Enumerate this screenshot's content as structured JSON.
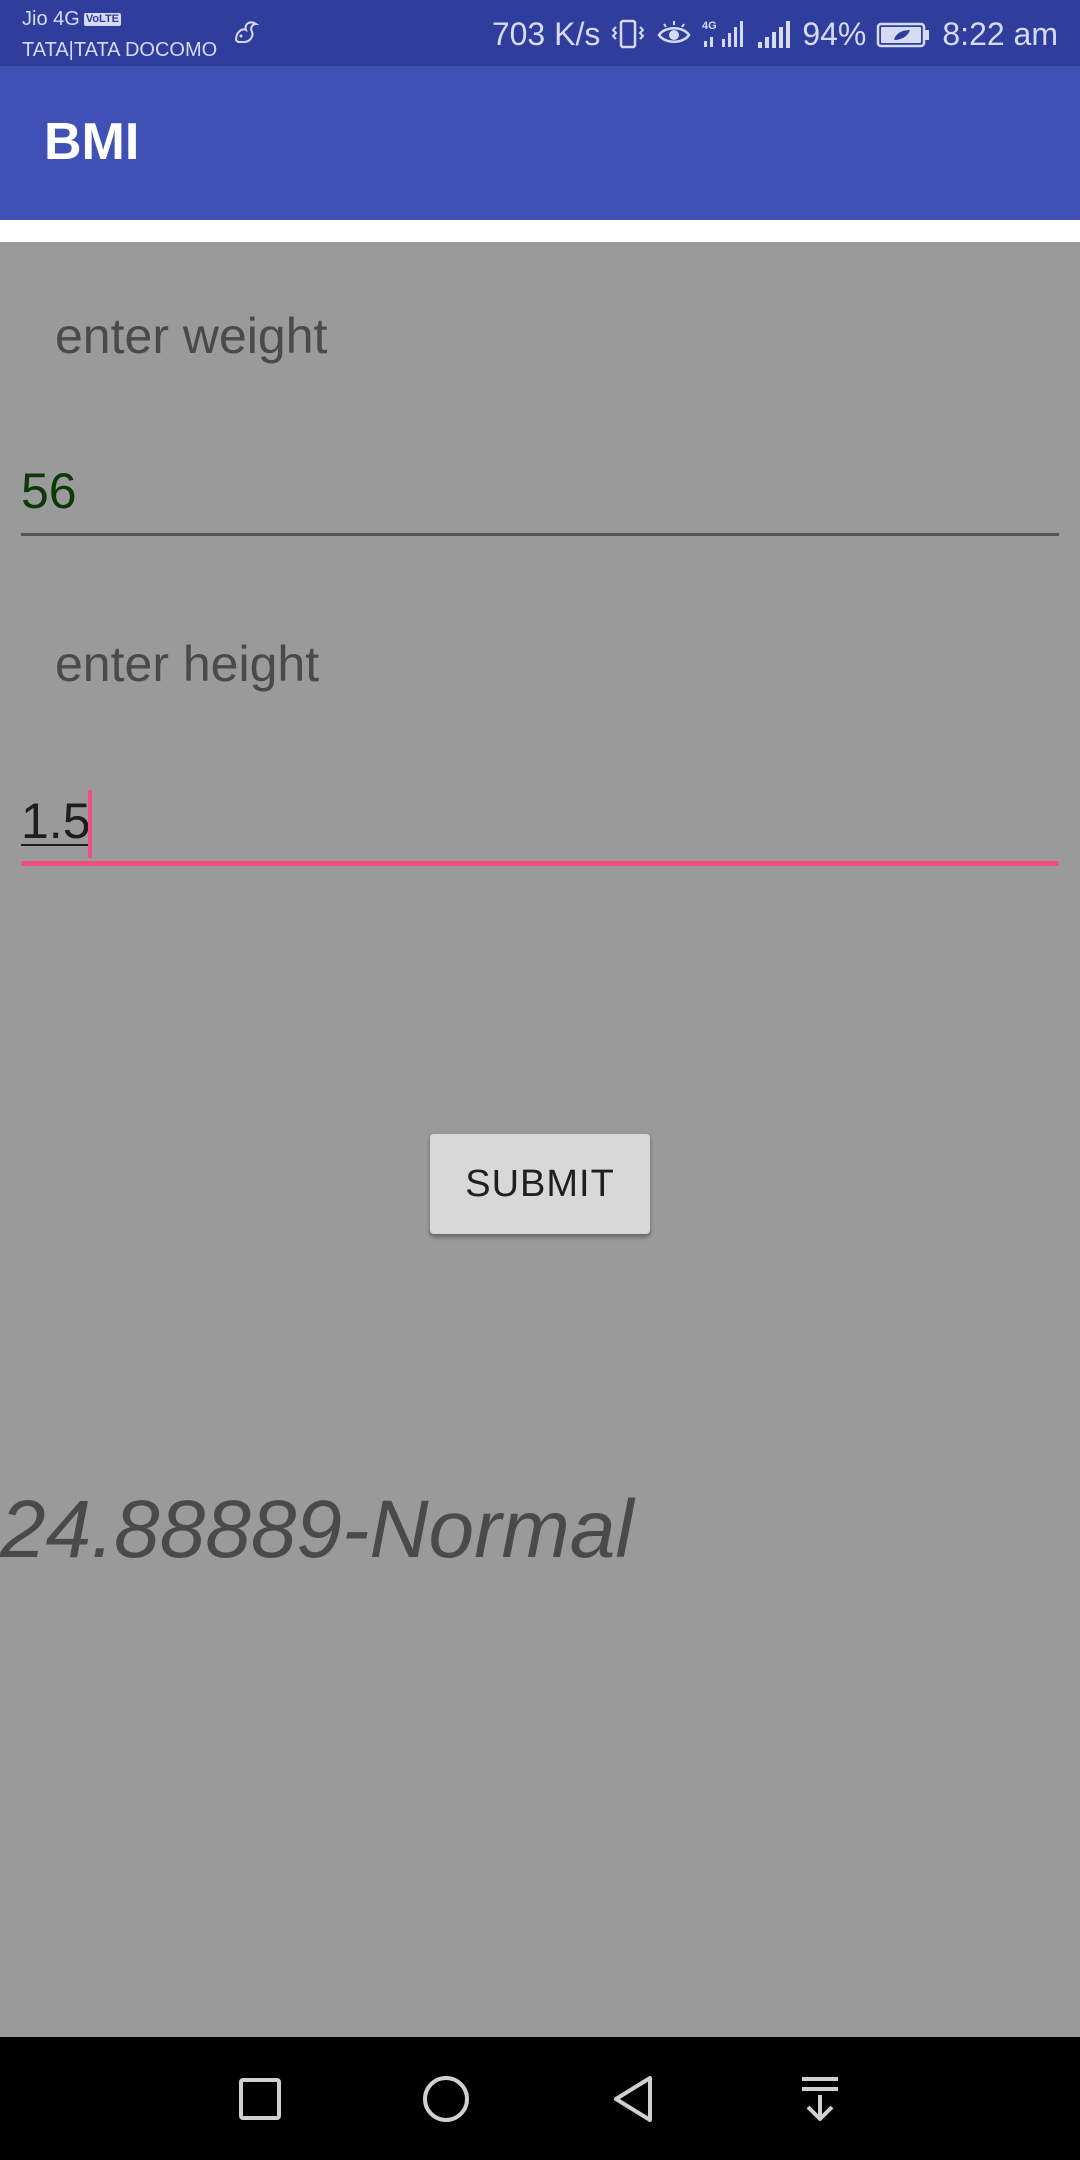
{
  "status_bar": {
    "carrier_primary": "Jio 4G",
    "volte_badge": "VoLTE",
    "carrier_secondary": "TATA|TATA DOCOMO",
    "network_speed": "703 K/s",
    "battery_percent": "94%",
    "time": "8:22 am",
    "icons": [
      "squirrel-icon",
      "vibrate-icon",
      "eye-comfort-icon",
      "4g-signal-icon",
      "signal-icon",
      "battery-icon"
    ]
  },
  "app_bar": {
    "title": "BMI"
  },
  "form": {
    "weight_label": "enter weight",
    "weight_value": "56",
    "height_label": "enter height",
    "height_value": "1.5",
    "submit_label": "SUBMIT"
  },
  "result": {
    "text": "24.88889-Normal"
  },
  "nav_bar": {
    "buttons": [
      "recents-square-icon",
      "home-circle-icon",
      "back-triangle-icon",
      "notification-pulldown-icon"
    ]
  },
  "colors": {
    "status_bar": "#2f3d9c",
    "app_bar": "#3f51b5",
    "background": "#9a9a9a",
    "accent": "#ee4f7e",
    "weight_text": "#0c3a07"
  }
}
